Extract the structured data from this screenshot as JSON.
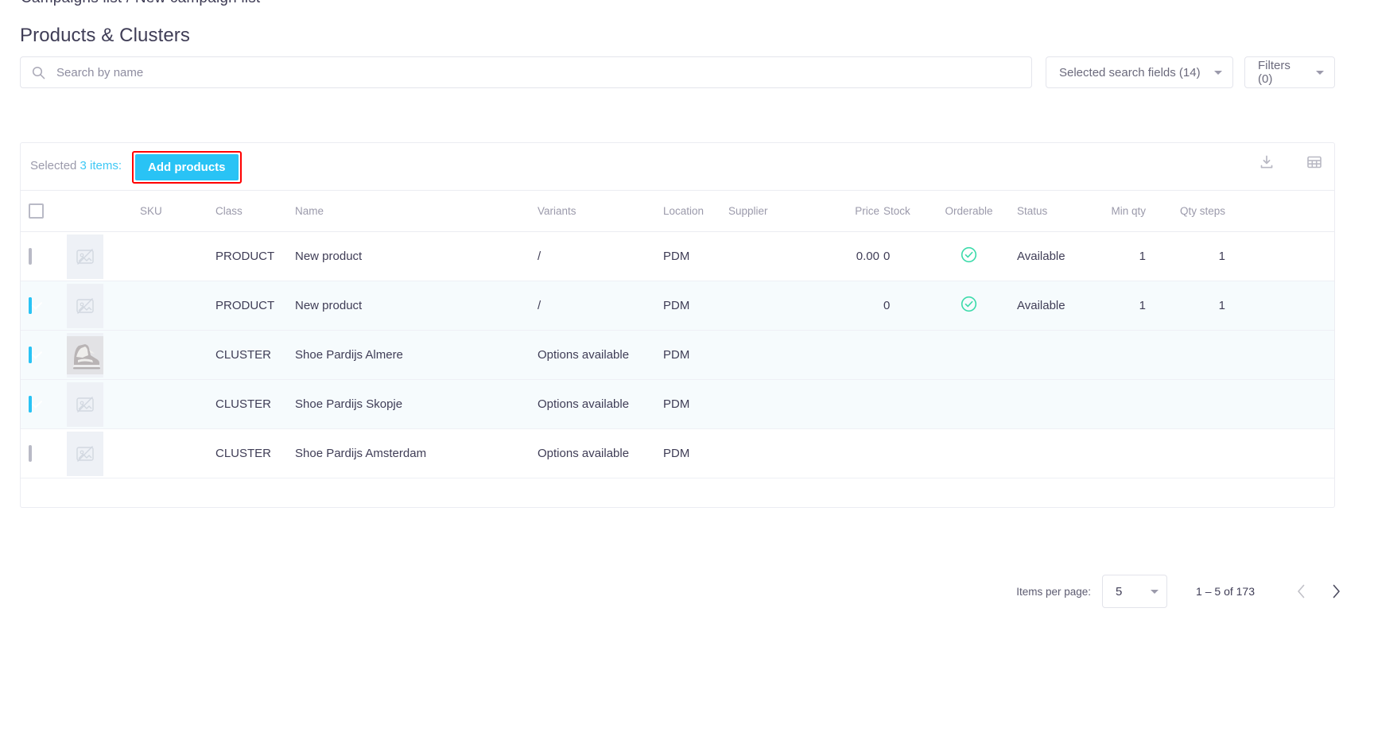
{
  "breadcrumb": {
    "text": "Campaigns list / New campaign list"
  },
  "header": {
    "title": "Products & Clusters"
  },
  "search": {
    "placeholder": "Search by name",
    "value": "",
    "icon": "search-icon",
    "fields_dropdown": "Selected search fields (14)",
    "filters_dropdown": "Filters (0)"
  },
  "toolbar": {
    "selected_prefix": "Selected",
    "selected_count": "3 items:",
    "add_products_label": "Add products",
    "download_icon": "download-icon",
    "columns_icon": "grid-columns-icon",
    "highlight_color": "#ff0000",
    "accent_color": "#29c3f5"
  },
  "table": {
    "columns": [
      "SKU",
      "Class",
      "Name",
      "Variants",
      "Location",
      "Supplier",
      "Price",
      "Stock",
      "Orderable",
      "Status",
      "Min qty",
      "Qty steps"
    ],
    "rows": [
      {
        "checked": false,
        "focused": false,
        "image": "placeholder",
        "sku": "",
        "class": "PRODUCT",
        "name": "New product",
        "variants": "/",
        "location": "PDM",
        "supplier": "",
        "price": "0.00",
        "stock": "0",
        "orderable": true,
        "status": "Available",
        "min_qty": "1",
        "qty_steps": "1"
      },
      {
        "checked": true,
        "focused": false,
        "image": "placeholder",
        "sku": "",
        "class": "PRODUCT",
        "name": "New product",
        "variants": "/",
        "location": "PDM",
        "supplier": "",
        "price": "",
        "stock": "0",
        "orderable": true,
        "status": "Available",
        "min_qty": "1",
        "qty_steps": "1"
      },
      {
        "checked": true,
        "focused": false,
        "image": "shoe",
        "sku": "",
        "class": "CLUSTER",
        "name": "Shoe Pardijs Almere",
        "variants": "Options available",
        "location": "PDM",
        "supplier": "",
        "price": "",
        "stock": "",
        "orderable": false,
        "status": "",
        "min_qty": "",
        "qty_steps": ""
      },
      {
        "checked": true,
        "focused": true,
        "image": "placeholder",
        "sku": "",
        "class": "CLUSTER",
        "name": "Shoe Pardijs Skopje",
        "variants": "Options available",
        "location": "PDM",
        "supplier": "",
        "price": "",
        "stock": "",
        "orderable": false,
        "status": "",
        "min_qty": "",
        "qty_steps": ""
      },
      {
        "checked": false,
        "focused": false,
        "image": "placeholder",
        "sku": "",
        "class": "CLUSTER",
        "name": "Shoe Pardijs Amsterdam",
        "variants": "Options available",
        "location": "PDM",
        "supplier": "",
        "price": "",
        "stock": "",
        "orderable": false,
        "status": "",
        "min_qty": "",
        "qty_steps": ""
      }
    ]
  },
  "paginator": {
    "items_per_page_label": "Items per page:",
    "page_size": "5",
    "range": "1 – 5 of 173",
    "prev_icon": "chevron-left-icon",
    "next_icon": "chevron-right-icon",
    "prev_disabled": true
  }
}
